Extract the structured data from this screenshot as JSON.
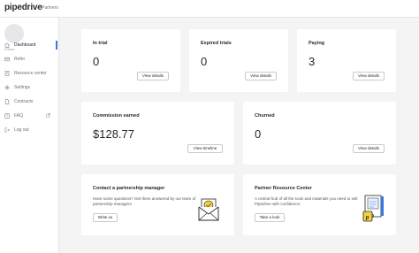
{
  "header": {
    "logo": "pipedrive",
    "section": "Partners"
  },
  "sidebar": {
    "username": "eRose",
    "items": [
      {
        "label": "Dashboard",
        "icon": "home-icon"
      },
      {
        "label": "Refer",
        "icon": "refer-icon"
      },
      {
        "label": "Resource center",
        "icon": "book-icon"
      },
      {
        "label": "Settings",
        "icon": "gear-icon"
      },
      {
        "label": "Contracts",
        "icon": "document-icon"
      },
      {
        "label": "FAQ",
        "icon": "question-icon"
      },
      {
        "label": "Log out",
        "icon": "logout-icon"
      }
    ]
  },
  "cards": {
    "in_trial": {
      "title": "In trial",
      "value": "0",
      "button": "View details"
    },
    "expired_trials": {
      "title": "Expired trials",
      "value": "0",
      "button": "View details"
    },
    "paying": {
      "title": "Paying",
      "value": "3",
      "button": "View details"
    },
    "commission": {
      "title": "Commission earned",
      "value": "$128.77",
      "button": "View timeline"
    },
    "churned": {
      "title": "Churned",
      "value": "0",
      "button": "View details"
    },
    "contact": {
      "title": "Contact a partnership manager",
      "text_line1": "Have some questions? Get them answered by our team of",
      "text_line2": "partnership managers.",
      "button": "Write us"
    },
    "resource": {
      "title": "Partner Resource Center",
      "text_line1": "A central hub of all the tools and materials you need to sell",
      "text_line2": "Pipedrive with confidence.",
      "button": "Take a look"
    }
  },
  "colors": {
    "accent": "#317ae2",
    "sticker": "#f5d23c",
    "background": "#f4f4f5"
  }
}
